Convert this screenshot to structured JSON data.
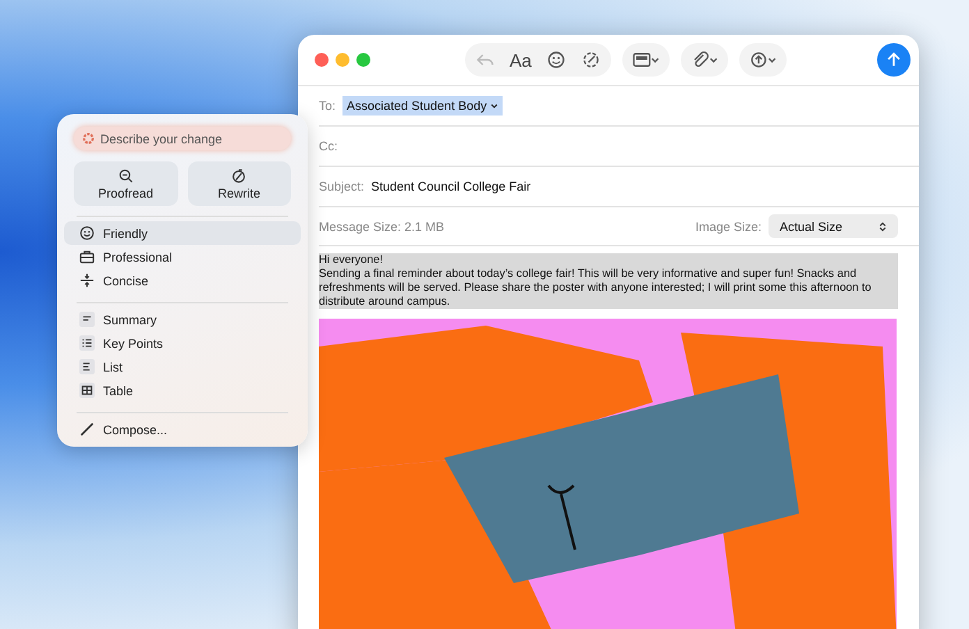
{
  "toolbar": {
    "format_label": "Aa"
  },
  "header": {
    "to_label": "To:",
    "to_value": "Associated Student Body",
    "cc_label": "Cc:",
    "subject_label": "Subject:",
    "subject_value": "Student Council College Fair",
    "message_size": "Message Size: 2.1 MB",
    "image_size_label": "Image Size:",
    "image_size_value": "Actual Size"
  },
  "body": {
    "selected": true,
    "lines": [
      "Hi everyone!",
      "Sending a final reminder about today’s college fair! This will be very informative and super fun! Snacks and refreshments will be served. Please share the poster with anyone interested; I will print some this afternoon to distribute around campus."
    ]
  },
  "writing_tools": {
    "placeholder": "Describe your change",
    "actions": [
      {
        "kind": "proofread",
        "label": "Proofread"
      },
      {
        "kind": "rewrite",
        "label": "Rewrite"
      }
    ],
    "tones": [
      {
        "kind": "friendly",
        "label": "Friendly",
        "selected": true
      },
      {
        "kind": "professional",
        "label": "Professional",
        "selected": false
      },
      {
        "kind": "concise",
        "label": "Concise",
        "selected": false
      }
    ],
    "formats": [
      {
        "kind": "summary",
        "label": "Summary"
      },
      {
        "kind": "keypoints",
        "label": "Key Points"
      },
      {
        "kind": "list",
        "label": "List"
      },
      {
        "kind": "table",
        "label": "Table"
      }
    ],
    "compose": "Compose..."
  }
}
